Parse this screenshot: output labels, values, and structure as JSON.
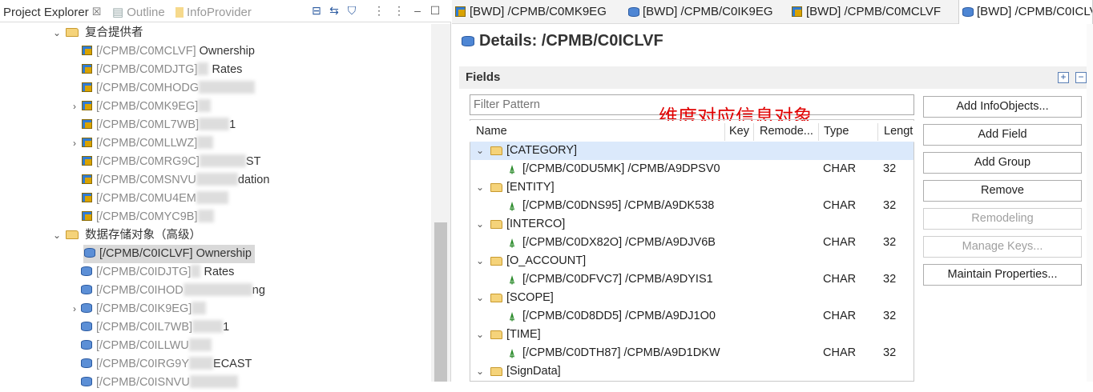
{
  "left_tabs": {
    "project_explorer": "Project Explorer",
    "outline": "Outline",
    "infoprovider": "InfoProvider"
  },
  "tree": {
    "composite_folder": "复合提供者",
    "composite_items": [
      {
        "key": "[/CPMB/C0MCLVF]",
        "suffix": " Ownership",
        "blur": 0,
        "expander": ""
      },
      {
        "key": "[/CPMB/C0MDJTG]",
        "suffix": " Rates",
        "blur": 14,
        "expander": ""
      },
      {
        "key": "[/CPMB/C0MHODG",
        "suffix": "",
        "blur": 70,
        "expander": ""
      },
      {
        "key": "[/CPMB/C0MK9EG]",
        "suffix": "",
        "blur": 16,
        "expander": ">"
      },
      {
        "key": "[/CPMB/C0ML7WB]",
        "suffix": "1",
        "blur": 38,
        "expander": ""
      },
      {
        "key": "[/CPMB/C0MLLWZ]",
        "suffix": "",
        "blur": 20,
        "expander": ">"
      },
      {
        "key": "[/CPMB/C0MRG9C]",
        "suffix": "ST",
        "blur": 58,
        "expander": ""
      },
      {
        "key": "[/CPMB/C0MSNVU",
        "suffix": "dation",
        "blur": 52,
        "expander": ""
      },
      {
        "key": "[/CPMB/C0MU4EM",
        "suffix": "",
        "blur": 40,
        "expander": ""
      },
      {
        "key": "[/CPMB/C0MYC9B]",
        "suffix": "",
        "blur": 20,
        "expander": ""
      }
    ],
    "dso_folder": "数据存储对象（高级）",
    "dso_items": [
      {
        "key": "[/CPMB/C0ICLVF]",
        "suffix": " Ownership",
        "blur": 0,
        "expander": "",
        "selected": true
      },
      {
        "key": "[/CPMB/C0IDJTG]",
        "suffix": " Rates",
        "blur": 12,
        "expander": ""
      },
      {
        "key": "[/CPMB/C0IHOD",
        "suffix": "ng",
        "blur": 86,
        "expander": ""
      },
      {
        "key": "[/CPMB/C0IK9EG]",
        "suffix": "",
        "blur": 18,
        "expander": ">"
      },
      {
        "key": "[/CPMB/C0IL7WB]",
        "suffix": "1",
        "blur": 38,
        "expander": ""
      },
      {
        "key": "[/CPMB/C0ILLWU",
        "suffix": "",
        "blur": 28,
        "expander": ""
      },
      {
        "key": "[/CPMB/C0IRG9Y",
        "suffix": "ECAST",
        "blur": 30,
        "expander": ""
      },
      {
        "key": "[/CPMB/C0ISNVU",
        "suffix": "",
        "blur": 60,
        "expander": ""
      }
    ]
  },
  "editor_tabs": [
    {
      "label": "[BWD] /CPMB/C0MK9EG",
      "icon": "composite-icon"
    },
    {
      "label": "[BWD] /CPMB/C0IK9EG",
      "icon": "dso-icon"
    },
    {
      "label": "[BWD] /CPMB/C0MCLVF",
      "icon": "composite-icon"
    },
    {
      "label": "[BWD] /CPMB/C0ICLV",
      "icon": "dso-icon"
    }
  ],
  "details_title": "Details: /CPMB/C0ICLVF",
  "fields_section_label": "Fields",
  "filter_placeholder": "Filter Pattern",
  "annotation": "维度对应信息对象",
  "columns": [
    "Name",
    "Key",
    "Remode...",
    "Type",
    "Lengt"
  ],
  "groups": [
    {
      "name": "[CATEGORY]",
      "field": "[/CPMB/C0DU5MK] /CPMB/A9DPSV0",
      "type": "CHAR",
      "length": "32"
    },
    {
      "name": "[ENTITY]",
      "field": "[/CPMB/C0DNS95] /CPMB/A9DK538",
      "type": "CHAR",
      "length": "32"
    },
    {
      "name": "[INTERCO]",
      "field": "[/CPMB/C0DX82O] /CPMB/A9DJV6B",
      "type": "CHAR",
      "length": "32"
    },
    {
      "name": "[O_ACCOUNT]",
      "field": "[/CPMB/C0DFVC7] /CPMB/A9DYIS1",
      "type": "CHAR",
      "length": "32"
    },
    {
      "name": "[SCOPE]",
      "field": "[/CPMB/C0D8DD5] /CPMB/A9DJ1O0",
      "type": "CHAR",
      "length": "32"
    },
    {
      "name": "[TIME]",
      "field": "[/CPMB/C0DTH87] /CPMB/A9D1DKW",
      "type": "CHAR",
      "length": "32"
    },
    {
      "name": "[SignData]",
      "field": "",
      "type": "",
      "length": ""
    }
  ],
  "buttons": [
    {
      "label": "Add InfoObjects...",
      "enabled": true
    },
    {
      "label": "Add Field",
      "enabled": true
    },
    {
      "label": "Add Group",
      "enabled": true
    },
    {
      "label": "Remove",
      "enabled": true
    },
    {
      "label": "Remodeling",
      "enabled": false
    },
    {
      "label": "Manage Keys...",
      "enabled": false
    },
    {
      "label": "Maintain Properties...",
      "enabled": true
    }
  ],
  "colors": {
    "annotation": "#e00000",
    "selection": "#dbe9fb"
  }
}
